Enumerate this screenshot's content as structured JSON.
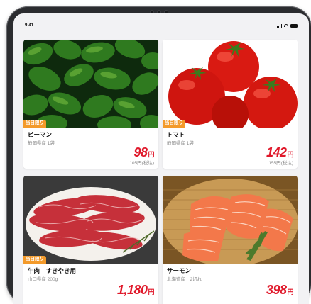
{
  "status_bar": {
    "time": "9:41"
  },
  "products": [
    {
      "badge": "当日限り",
      "name": "ピーマン",
      "origin": "静岡県産 1袋",
      "price": "98",
      "currency": "円",
      "tax_included": "105円(税込)",
      "image": "green-peppers"
    },
    {
      "badge": "当日限り",
      "name": "トマト",
      "origin": "静岡県産 1袋",
      "price": "142",
      "currency": "円",
      "tax_included": "155円(税込)",
      "image": "tomatoes"
    },
    {
      "badge": "当日限り",
      "name": "牛肉　すきやき用",
      "origin": "山口県産 200g",
      "price": "1,180",
      "currency": "円",
      "image": "sliced-beef"
    },
    {
      "badge": "",
      "name": "サーモン",
      "origin": "北海道産　2切れ",
      "price": "398",
      "currency": "円",
      "image": "salmon-fillets"
    }
  ],
  "colors": {
    "badge": "#f39a2a",
    "price": "#e0192b"
  }
}
